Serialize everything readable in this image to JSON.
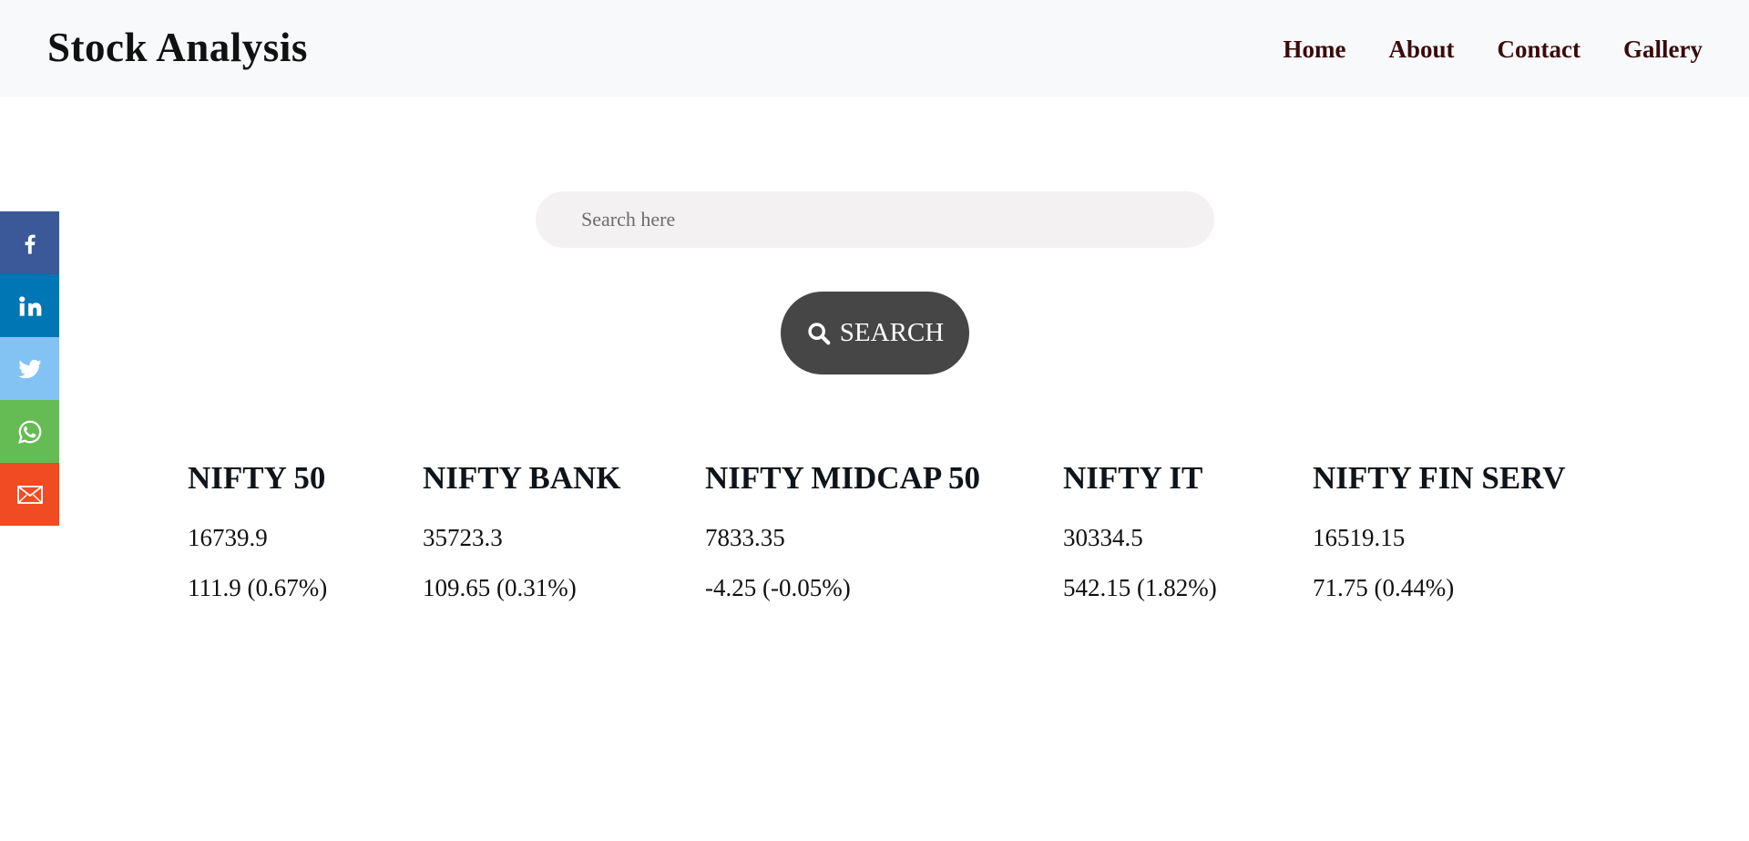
{
  "navbar": {
    "brand": "Stock Analysis",
    "links": [
      "Home",
      "About",
      "Contact",
      "Gallery"
    ],
    "background": "#f8f9fa",
    "link_color": "#3b0a0a"
  },
  "social": [
    {
      "icon": "facebook-icon",
      "color": "#3b5998"
    },
    {
      "icon": "linkedin-icon",
      "color": "#0077b5"
    },
    {
      "icon": "twitter-icon",
      "color": "#83c3f3"
    },
    {
      "icon": "whatsapp-icon",
      "color": "#65bc54"
    },
    {
      "icon": "mail-icon",
      "color": "#f04b23"
    }
  ],
  "search": {
    "placeholder": "Search here",
    "value": "",
    "button_label": "SEARCH",
    "button_icon": "search-icon",
    "button_color": "#464646"
  },
  "indices": [
    {
      "name": "NIFTY 50",
      "value": "16739.9",
      "change": "111.9 (0.67%)"
    },
    {
      "name": "NIFTY BANK",
      "value": "35723.3",
      "change": "109.65 (0.31%)"
    },
    {
      "name": "NIFTY MIDCAP 50",
      "value": "7833.35",
      "change": "-4.25 (-0.05%)"
    },
    {
      "name": "NIFTY IT",
      "value": "30334.5",
      "change": "542.15 (1.82%)"
    },
    {
      "name": "NIFTY FIN SERV",
      "value": "16519.15",
      "change": "71.75 (0.44%)"
    }
  ]
}
